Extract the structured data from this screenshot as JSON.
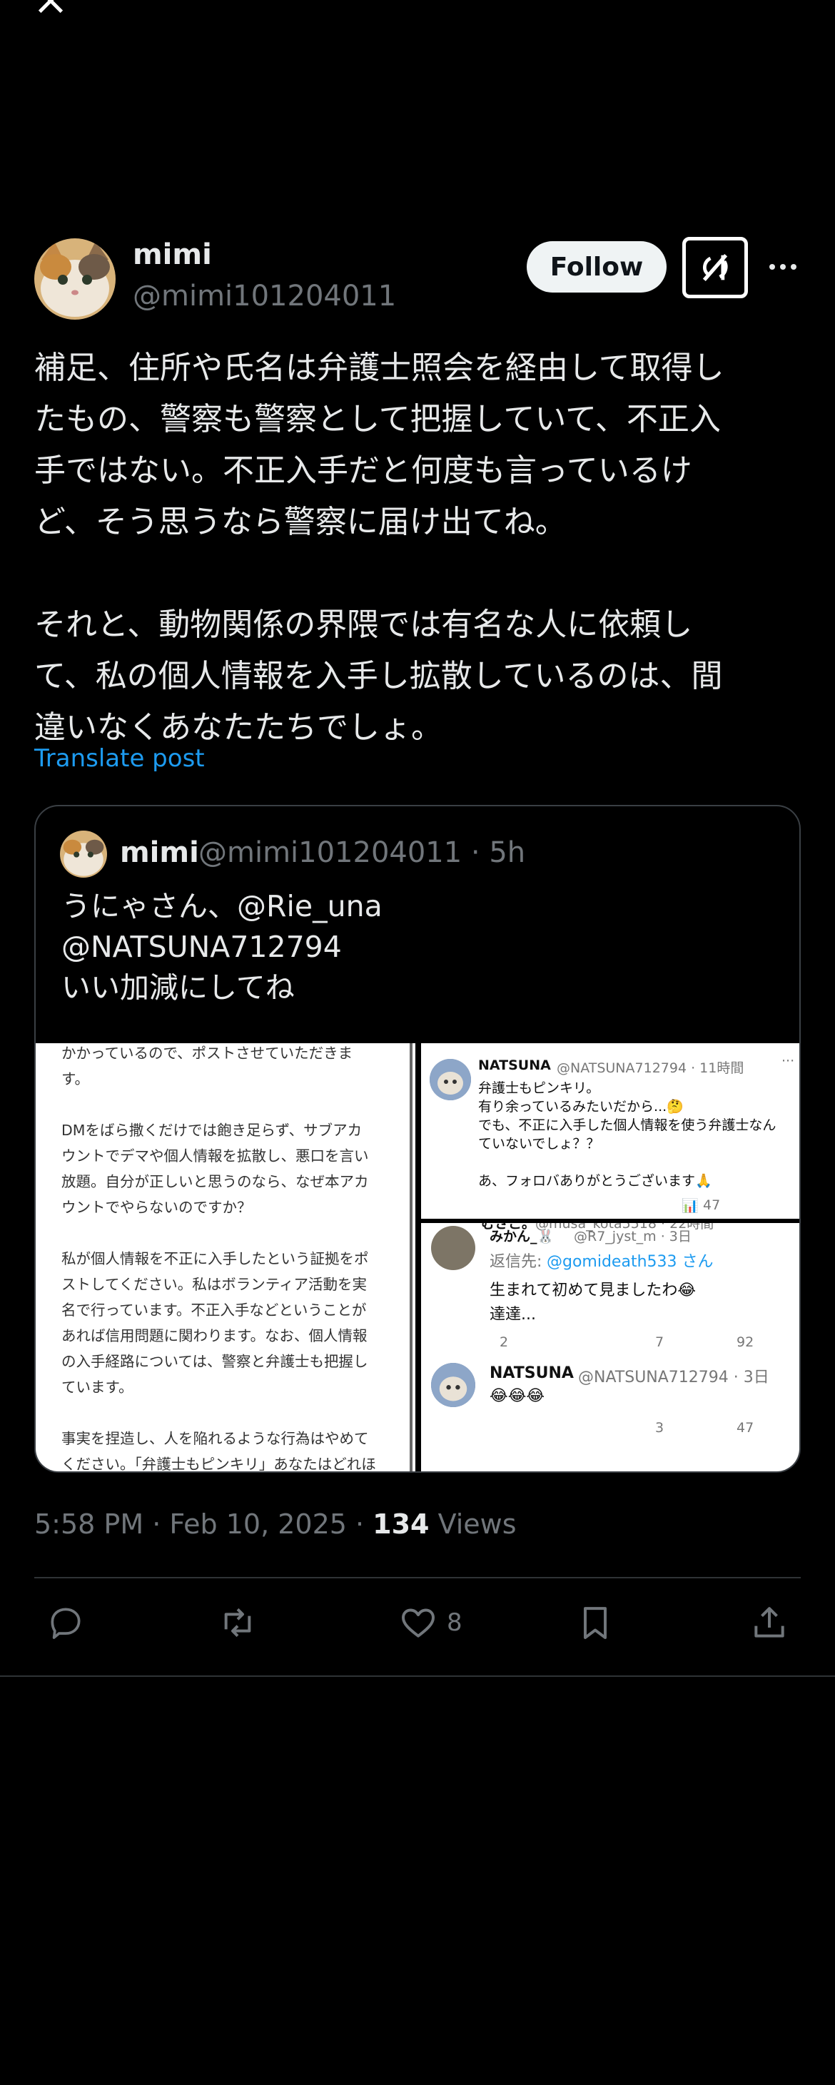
{
  "author": {
    "name": "mimi",
    "handle": "@mimi101204011"
  },
  "header": {
    "follow_label": "Follow"
  },
  "post": {
    "text": "補足、住所や氏名は弁護士照会を経由して取得し\nたもの、警察も警察として把握していて、不正入\n手ではない。不正入手だと何度も言っているけ\nど、そう思うなら警察に届け出てね。\n\nそれと、動物関係の界隈では有名な人に依頼し\nて、私の個人情報を入手し拡散しているのは、間\n違いなくあなたたちでしょ。",
    "translate_label": "Translate post",
    "time": "5:58 PM · Feb 10, 2025 · ",
    "views_count": "134",
    "views_label": " Views"
  },
  "quote": {
    "name": "mimi",
    "meta": "@mimi101204011 · 5h",
    "text": "うにゃさん、@Rie_una\n@NATSUNA712794\nいい加減にしてね",
    "image_left_text": "かかっているので、ポストさせていただきま\nす。\n\nDMをばら撒くだけでは飽き足らず、サブアカ\nウントでデマや個人情報を拡散し、悪口を言い\n放題。自分が正しいと思うのなら、なぜ本アカ\nウントでやらないのですか？\n\n私が個人情報を不正に入手したという証拠をポ\nストしてください。私はボランティア活動を実\n名で行っています。不正入手などということが\nあれば信用問題に関わります。なお、個人情報\nの入手経路については、警察と弁護士も把握し\nています。\n\n事実を捏造し、人を陥れるような行為はやめて\nください。「弁護士もピンキリ」あなたはどれほ",
    "right_top": {
      "name": "NATSUNA",
      "meta": "@NATSUNA712794 · 11時間",
      "line1": "弁護士もピンキリ。",
      "line2": "有り余っているみたいだから...🤔",
      "line3": "でも、不正に入手した個人情報を使う弁護士なん",
      "line4": "ていないでしょ？？",
      "line5": "あ、フォロバありがとうございます🙏",
      "views": "47"
    },
    "right_bottom": {
      "head_name": "むさこ。",
      "head_meta": "@musa_kota5518 · 22時間",
      "reply_name": "みかん_🐰",
      "reply_meta": "@R7_jyst_m · 3日",
      "reply_to_label": "返信先: ",
      "reply_to_handle": "@gomideath533 さん",
      "reply_line1": "生まれて初めて見ましたわ😂",
      "reply_line2": "達達...",
      "reply_views": "92",
      "reply_likes": "7",
      "reply_replies": "2",
      "n_name": "NATSUNA",
      "n_meta": "@NATSUNA712794 · 3日",
      "n_text": "😂😂😂",
      "n_views": "47",
      "n_likes": "3"
    }
  },
  "actions": {
    "like_count": "8"
  },
  "icons": [
    "close-icon",
    "grok-icon",
    "more-icon",
    "reply-icon",
    "repost-icon",
    "like-icon",
    "bookmark-icon",
    "share-icon"
  ]
}
